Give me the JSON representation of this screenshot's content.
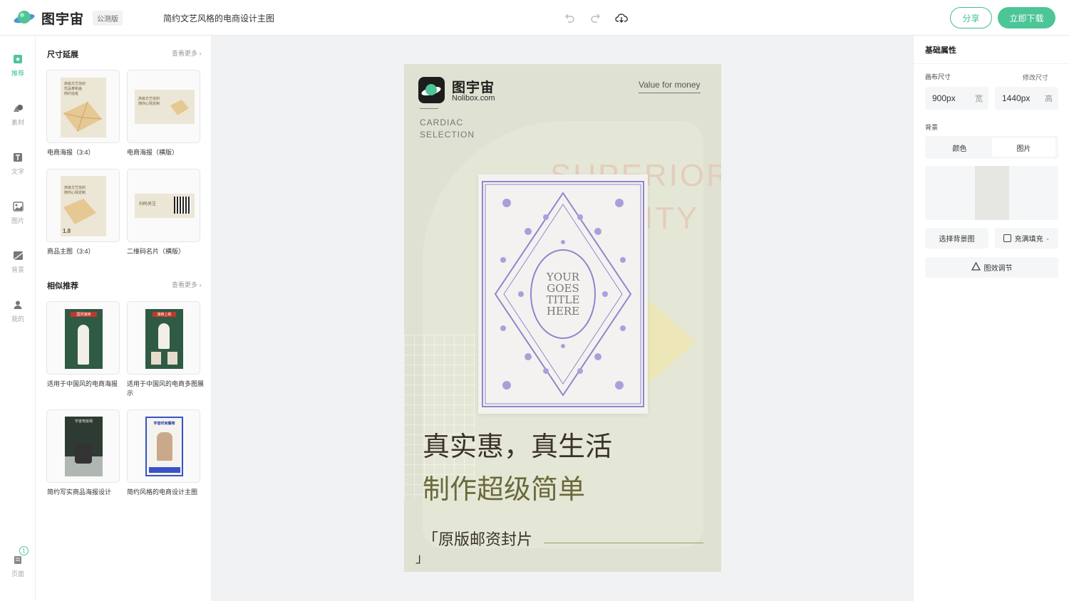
{
  "header": {
    "brand": "图宇宙",
    "badge": "公测版",
    "doc_title": "简约文艺风格的电商设计主图",
    "share": "分享",
    "download": "立即下载"
  },
  "nav": [
    {
      "label": "推荐",
      "icon": "recommend-icon"
    },
    {
      "label": "素材",
      "icon": "shapes-icon"
    },
    {
      "label": "文字",
      "icon": "text-icon"
    },
    {
      "label": "图片",
      "icon": "image-icon"
    },
    {
      "label": "背景",
      "icon": "background-icon"
    },
    {
      "label": "我的",
      "icon": "user-icon"
    },
    {
      "label": "页面",
      "icon": "pages-icon",
      "count": "1"
    }
  ],
  "panel": {
    "size_section": {
      "title": "尺寸延展",
      "more": "查看更多",
      "items": [
        {
          "label": "电商海报（3:4）",
          "thumb_text": "高级文艺信封\n优品革新画\n简约信纸"
        },
        {
          "label": "电商海报（横版）",
          "thumb_text": "高级文艺信封\n随你心情定制"
        },
        {
          "label": "商品主图（3:4）",
          "thumb_text": "高级文艺信封\n随你心情定制",
          "price": "1.8"
        },
        {
          "label": "二维码名片（横版）",
          "thumb_text": "扫码关注"
        }
      ]
    },
    "similar_section": {
      "title": "相似推荐",
      "more": "查看更多",
      "items": [
        {
          "label": "适用于中国风的电商海报",
          "thumb_text": "国风旗袍"
        },
        {
          "label": "适用于中国风的电商多图展示",
          "thumb_text": "旗袍上新"
        },
        {
          "label": "简约写实商品海报设计",
          "thumb_text": "宇宙电饭锅"
        },
        {
          "label": "简约风格的电商设计主图",
          "thumb_text": "宇宙时尚餐椅"
        }
      ]
    }
  },
  "poster": {
    "brand_cn": "图宇宙",
    "brand_url": "Nolibox.com",
    "tagline": "Value for money",
    "sub1": "CARDIAC",
    "sub2": "SELECTION",
    "bg_word1": "SUPERIOR",
    "bg_word2": "QUALITY",
    "card_line1": "YOUR",
    "card_line2": "GOES",
    "card_line3": "TITLE",
    "card_line4": "HERE",
    "headline1": "真实惠，真生活",
    "headline2": "制作超级简单",
    "footer": "「原版邮资封片",
    "footer_close": "」",
    "colors": {
      "bg": "#dfe1d2",
      "olive": "#6b6a3c",
      "card_ink": "#8f86cc",
      "arch": "#e8ead6"
    }
  },
  "right": {
    "title": "基础属性",
    "canvas_size_label": "画布尺寸",
    "resize_link": "修改尺寸",
    "width_value": "900px",
    "width_unit": "宽",
    "height_value": "1440px",
    "height_unit": "高",
    "background_label": "背景",
    "tab_color": "颜色",
    "tab_image": "图片",
    "select_bg": "选择背景图",
    "fill_mode": "充满填充",
    "effect_adjust": "图效调节"
  },
  "theme": {
    "accent": "#4cc597",
    "accent_dark": "#3fbf8c"
  }
}
